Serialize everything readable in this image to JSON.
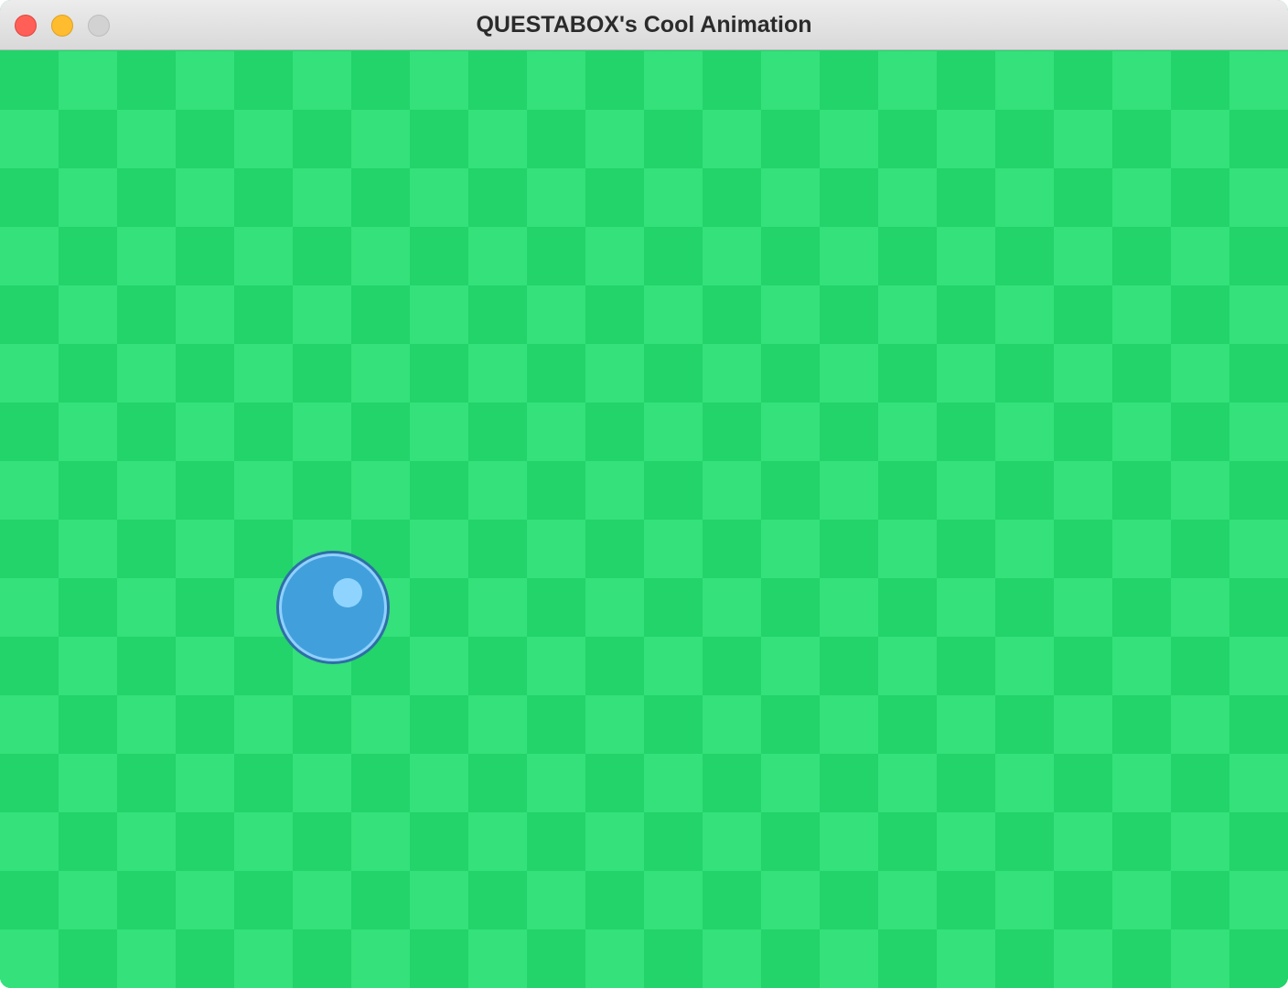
{
  "window": {
    "title": "QUESTABOX's Cool Animation"
  },
  "colors": {
    "checker_dark": "#22d46a",
    "checker_light": "#35e17a",
    "ball_fill": "#41a0dc",
    "ball_rim": "#8fd0ff",
    "ball_outline": "#2e6fa6",
    "ball_highlight": "#8fd4ff",
    "close": "#ff5f57",
    "minimize": "#febc2e",
    "zoom": "#d2d2d2"
  },
  "icons": {
    "close": "close-traffic-light-icon",
    "minimize": "minimize-traffic-light-icon",
    "zoom": "zoom-traffic-light-icon"
  }
}
